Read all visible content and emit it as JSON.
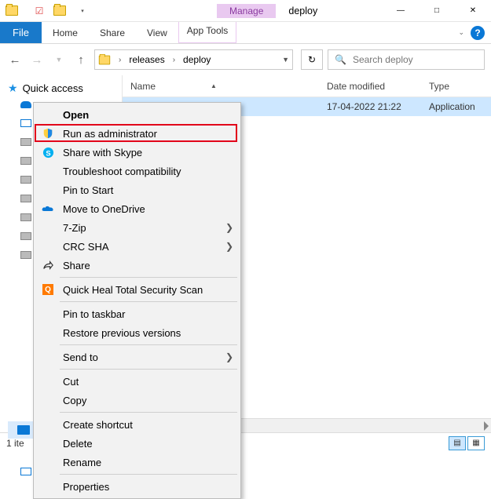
{
  "window": {
    "manage_label": "Manage",
    "apptools_label": "App Tools",
    "title": "deploy"
  },
  "tabs": {
    "file": "File",
    "home": "Home",
    "share": "Share",
    "view": "View"
  },
  "address": {
    "crumb1": "releases",
    "crumb2": "deploy"
  },
  "search": {
    "placeholder": "Search deploy"
  },
  "sidebar": {
    "quick_access": "Quick access"
  },
  "columns": {
    "name": "Name",
    "date": "Date modified",
    "type": "Type"
  },
  "rows": [
    {
      "name": "",
      "date": "17-04-2022 21:22",
      "type": "Application"
    }
  ],
  "status": {
    "text": "1 ite"
  },
  "ctx": {
    "open": "Open",
    "run_admin": "Run as administrator",
    "share_skype": "Share with Skype",
    "troubleshoot": "Troubleshoot compatibility",
    "pin_start": "Pin to Start",
    "onedrive": "Move to OneDrive",
    "seven_zip": "7-Zip",
    "crc": "CRC SHA",
    "share": "Share",
    "quickheal": "Quick Heal Total Security Scan",
    "pin_taskbar": "Pin to taskbar",
    "restore": "Restore previous versions",
    "sendto": "Send to",
    "cut": "Cut",
    "copy": "Copy",
    "shortcut": "Create shortcut",
    "delete": "Delete",
    "rename": "Rename",
    "properties": "Properties"
  }
}
